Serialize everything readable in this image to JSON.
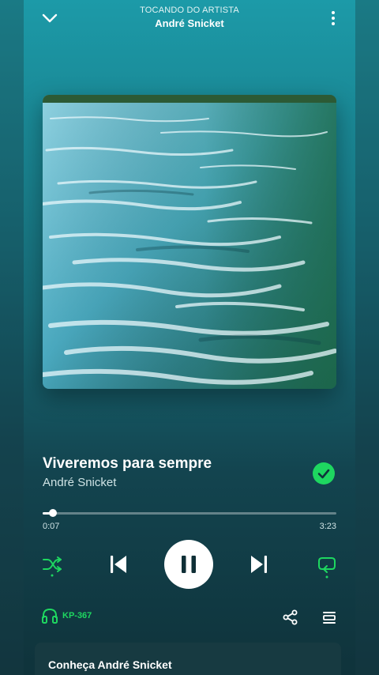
{
  "header": {
    "context_label": "TOCANDO DO ARTISTA",
    "artist_name": "André Snicket"
  },
  "track": {
    "title": "Viveremos para sempre",
    "artist": "André Snicket",
    "liked": true
  },
  "playback": {
    "elapsed": "0:07",
    "duration": "3:23",
    "progress_fraction": 0.035,
    "state": "playing",
    "shuffle_active": true,
    "repeat_active": true
  },
  "device": {
    "name": "KP-367",
    "icon": "headphones-icon"
  },
  "about": {
    "title": "Conheça André Snicket"
  },
  "colors": {
    "accent": "#1ed760",
    "background_top": "#1c9aa8",
    "background_bottom": "#0f333b"
  }
}
